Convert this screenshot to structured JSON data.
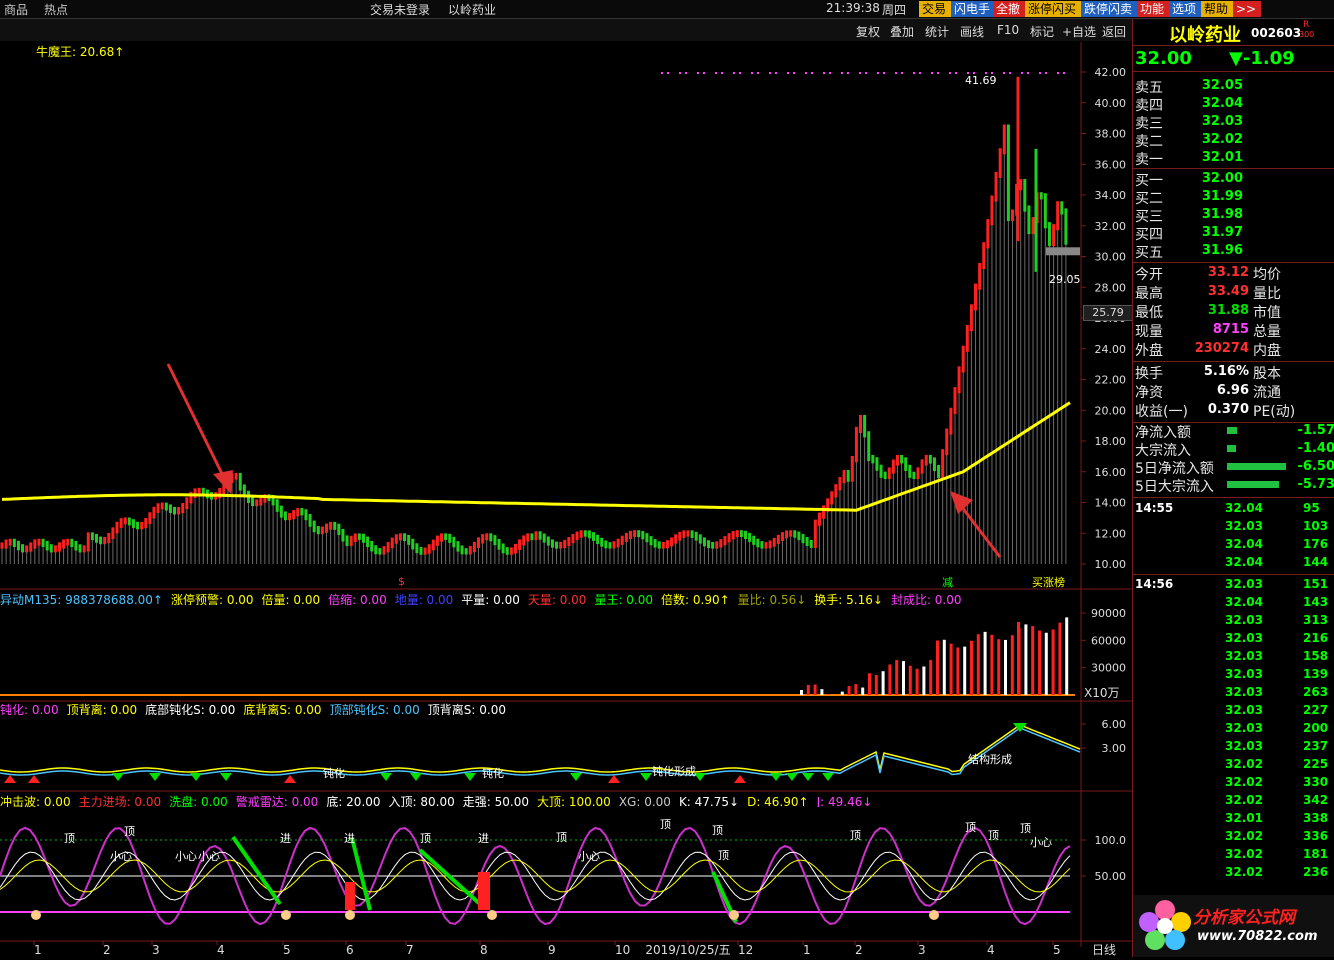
{
  "topbar": {
    "left_items": [
      "商品",
      "热点"
    ],
    "login": "交易未登录",
    "stock": "以岭药业",
    "time": "21:39:38",
    "weekday": "周四",
    "buttons": [
      {
        "label": "交易",
        "bg": "#e8b000",
        "fg": "#000"
      },
      {
        "label": "闪电手",
        "bg": "#1f5fbf",
        "fg": "#fff"
      },
      {
        "label": "全撤",
        "bg": "#d52020",
        "fg": "#fff"
      },
      {
        "label": "涨停闪买",
        "bg": "#e8b000",
        "fg": "#000"
      },
      {
        "label": "跌停闪卖",
        "bg": "#1f5fbf",
        "fg": "#fff"
      },
      {
        "label": "功能",
        "bg": "#d52020",
        "fg": "#fff"
      },
      {
        "label": "选项",
        "bg": "#1f5fbf",
        "fg": "#fff"
      },
      {
        "label": "帮助",
        "bg": "#e8b000",
        "fg": "#000"
      },
      {
        "label": ">>",
        "bg": "#d52020",
        "fg": "#fff"
      }
    ]
  },
  "toolbar": {
    "items": [
      "复权",
      "叠加",
      "统计",
      "画线",
      "F10",
      "标记",
      "+自选",
      "返回"
    ]
  },
  "main_chart": {
    "indicator_label": "牛魔王: 20.68↑",
    "y_ticks": [
      "42.00",
      "40.00",
      "38.00",
      "36.00",
      "34.00",
      "32.00",
      "30.00",
      "28.00",
      "26.00",
      "24.00",
      "22.00",
      "20.00",
      "18.00",
      "16.00",
      "14.00",
      "12.00",
      "10.00"
    ],
    "current_price_tag": "25.79",
    "high_label": "41.69",
    "low_label": "29.05",
    "signal_labels": [
      "$",
      "减",
      "买涨榜"
    ]
  },
  "panel_vol": {
    "legend": [
      {
        "text": "异动M135: 988378688.00↑",
        "color": "#4cc4ff"
      },
      {
        "text": "涨停预警: 0.00",
        "color": "#ffff00"
      },
      {
        "text": "倍量: 0.00",
        "color": "#ffff00"
      },
      {
        "text": "倍缩: 0.00",
        "color": "#ff40ff"
      },
      {
        "text": "地量: 0.00",
        "color": "#4040ff"
      },
      {
        "text": "平量: 0.00",
        "color": "#ffffff"
      },
      {
        "text": "天量: 0.00",
        "color": "#ff3030"
      },
      {
        "text": "量王: 0.00",
        "color": "#00ff00"
      },
      {
        "text": "倍数: 0.90↑",
        "color": "#ffff00"
      },
      {
        "text": "量比: 0.56↓",
        "color": "#a0a000"
      },
      {
        "text": "换手: 5.16↓",
        "color": "#ffff00"
      },
      {
        "text": "封成比: 0.00",
        "color": "#ff40ff"
      }
    ],
    "y_ticks": [
      "90000",
      "60000",
      "30000"
    ],
    "unit": "X10万"
  },
  "panel_macd": {
    "legend": [
      {
        "text": "钝化: 0.00",
        "color": "#ff40ff"
      },
      {
        "text": "顶背离: 0.00",
        "color": "#ffff00"
      },
      {
        "text": "底部钝化S: 0.00",
        "color": "#ffffff"
      },
      {
        "text": "底背离S: 0.00",
        "color": "#ffff00"
      },
      {
        "text": "顶部钝化S: 0.00",
        "color": "#4cc4ff"
      },
      {
        "text": "顶背离S: 0.00",
        "color": "#ffffff"
      }
    ],
    "y_ticks": [
      "6.00",
      "3.00"
    ],
    "labels": [
      "钝化",
      "钝化",
      "钝化形成",
      "结构形成"
    ]
  },
  "panel_kdj": {
    "legend": [
      {
        "text": "冲击波: 0.00",
        "color": "#ffff00"
      },
      {
        "text": "主力进场: 0.00",
        "color": "#ff3030"
      },
      {
        "text": "洗盘: 0.00",
        "color": "#00ff00"
      },
      {
        "text": "警戒雷达: 0.00",
        "color": "#ff40ff"
      },
      {
        "text": "底: 20.00",
        "color": "#ffffff"
      },
      {
        "text": "入顶: 80.00",
        "color": "#ffffff"
      },
      {
        "text": "走强: 50.00",
        "color": "#ffffff"
      },
      {
        "text": "大顶: 100.00",
        "color": "#ffff00"
      },
      {
        "text": "XG: 0.00",
        "color": "#c8c8c8"
      },
      {
        "text": "K: 47.75↓",
        "color": "#ffffff"
      },
      {
        "text": "D: 46.90↑",
        "color": "#ffff00"
      },
      {
        "text": "J: 49.46↓",
        "color": "#ff40ff"
      }
    ],
    "y_ticks": [
      "100.0",
      "50.00"
    ],
    "labels": [
      "顶",
      "顶",
      "进",
      "进",
      "进",
      "顶",
      "顶",
      "顶",
      "顶",
      "顶",
      "顶",
      "顶",
      "顶",
      "顶",
      "小心",
      "小心",
      "小心",
      "小心",
      "小心"
    ]
  },
  "x_axis": {
    "ticks": [
      "1",
      "2",
      "3",
      "4",
      "5",
      "6",
      "7",
      "8",
      "9",
      "10",
      "2019/10/25/五",
      "12",
      "1",
      "2",
      "3",
      "4",
      "5"
    ],
    "period": "日线"
  },
  "right_panel": {
    "name": "以岭药业",
    "code": "002603",
    "badge_r": "R",
    "badge_num": "300",
    "price": "32.00",
    "change": "▼-1.09",
    "asks": [
      {
        "label": "卖五",
        "price": "32.05"
      },
      {
        "label": "卖四",
        "price": "32.04"
      },
      {
        "label": "卖三",
        "price": "32.03"
      },
      {
        "label": "卖二",
        "price": "32.02"
      },
      {
        "label": "卖一",
        "price": "32.01"
      }
    ],
    "bids": [
      {
        "label": "买一",
        "price": "32.00"
      },
      {
        "label": "买二",
        "price": "31.99"
      },
      {
        "label": "买三",
        "price": "31.98"
      },
      {
        "label": "买四",
        "price": "31.97"
      },
      {
        "label": "买五",
        "price": "31.96"
      }
    ],
    "stats": [
      {
        "l1": "今开",
        "v1": "33.12",
        "c1": "#ff3030",
        "l2": "均价"
      },
      {
        "l1": "最高",
        "v1": "33.49",
        "c1": "#ff3030",
        "l2": "量比"
      },
      {
        "l1": "最低",
        "v1": "31.88",
        "c1": "#00e000",
        "l2": "市值"
      },
      {
        "l1": "现量",
        "v1": "8715",
        "c1": "#ff40ff",
        "l2": "总量"
      },
      {
        "l1": "外盘",
        "v1": "230274",
        "c1": "#ff3030",
        "l2": "内盘"
      }
    ],
    "stats2": [
      {
        "l1": "换手",
        "v1": "5.16%",
        "l2": "股本"
      },
      {
        "l1": "净资",
        "v1": "6.96",
        "l2": "流通"
      },
      {
        "l1": "收益(一)",
        "v1": "0.370",
        "l2": "PE(动)"
      }
    ],
    "flows": [
      {
        "label": "净流入额",
        "value": "-1.57",
        "bar": 0.14
      },
      {
        "label": "大宗流入",
        "value": "-1.40",
        "bar": 0.12
      },
      {
        "label": "5日净流入额",
        "value": "-6.50",
        "bar": 0.82
      },
      {
        "label": "5日大宗流入",
        "value": "-5.73",
        "bar": 0.72
      }
    ],
    "ticks_1455": {
      "time": "14:55",
      "rows": [
        {
          "p": "32.04",
          "v": "95"
        },
        {
          "p": "32.03",
          "v": "103"
        },
        {
          "p": "32.04",
          "v": "176"
        },
        {
          "p": "32.04",
          "v": "144"
        }
      ]
    },
    "ticks_1456": {
      "time": "14:56",
      "rows": [
        {
          "p": "32.03",
          "v": "151"
        },
        {
          "p": "32.04",
          "v": "143"
        },
        {
          "p": "32.03",
          "v": "313"
        },
        {
          "p": "32.03",
          "v": "216"
        },
        {
          "p": "32.03",
          "v": "158"
        },
        {
          "p": "32.03",
          "v": "139"
        },
        {
          "p": "32.03",
          "v": "263"
        },
        {
          "p": "32.03",
          "v": "227"
        },
        {
          "p": "32.03",
          "v": "200"
        },
        {
          "p": "32.03",
          "v": "237"
        },
        {
          "p": "32.02",
          "v": "225"
        },
        {
          "p": "32.02",
          "v": "330"
        },
        {
          "p": "32.02",
          "v": "342"
        },
        {
          "p": "32.01",
          "v": "338"
        },
        {
          "p": "32.02",
          "v": "336"
        },
        {
          "p": "32.02",
          "v": "181"
        },
        {
          "p": "32.02",
          "v": "236"
        }
      ]
    },
    "watermark": {
      "title": "分析家公式网",
      "url": "www.70822.com"
    }
  }
}
